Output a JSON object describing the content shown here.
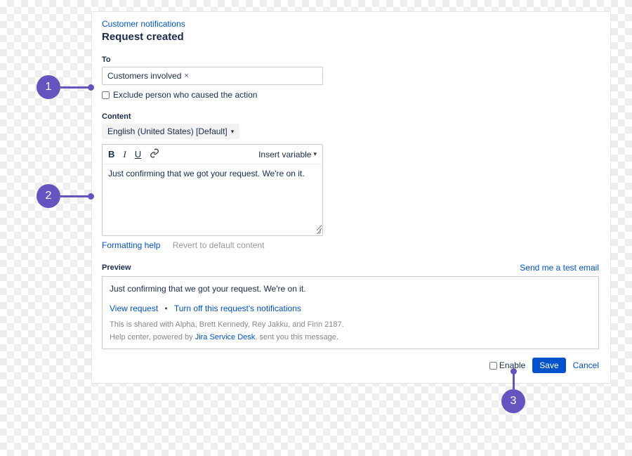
{
  "breadcrumb": "Customer notifications",
  "pageTitle": "Request created",
  "to": {
    "label": "To",
    "chip": "Customers involved",
    "excludeLabel": "Exclude person who caused the action"
  },
  "content": {
    "label": "Content",
    "language": "English (United States) [Default]",
    "insertVariable": "Insert variable",
    "body": "Just confirming that we got your request. We're on it.",
    "formattingHelp": "Formatting help",
    "revert": "Revert to default content"
  },
  "preview": {
    "label": "Preview",
    "testEmail": "Send me a test email",
    "body": "Just confirming that we got your request. We're on it.",
    "viewRequest": "View request",
    "turnOff": "Turn off this request's notifications",
    "sharedWith": "This is shared with Alpha, Brett Kennedy, Rey Jakku, and Finn 2187.",
    "helpCenterPrefix": "Help center, powered by ",
    "helpCenterLink": "Jira Service Desk",
    "helpCenterSuffix": ", sent you this message."
  },
  "footer": {
    "enable": "Enable",
    "save": "Save",
    "cancel": "Cancel"
  },
  "callouts": {
    "c1": "1",
    "c2": "2",
    "c3": "3"
  }
}
